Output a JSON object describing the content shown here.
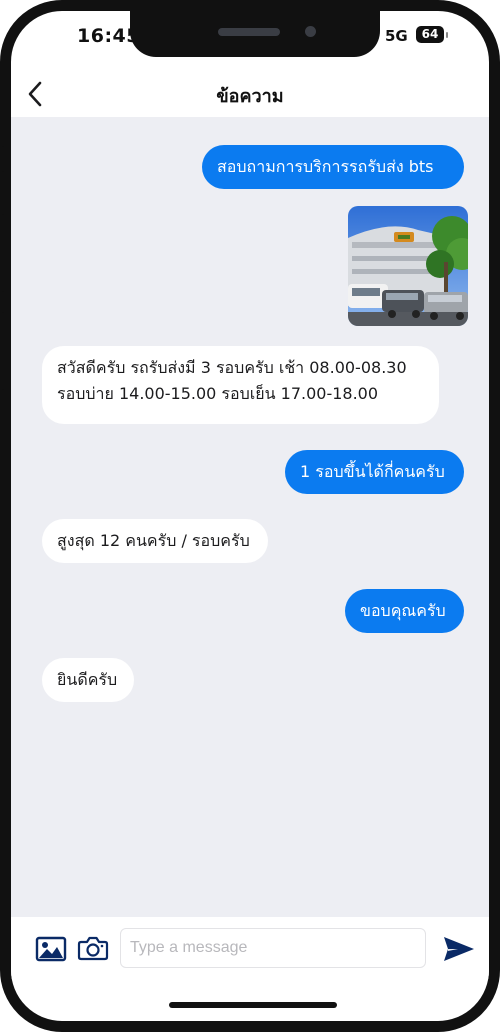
{
  "status_bar": {
    "time": "16:45",
    "network": "5G",
    "battery": "64"
  },
  "header": {
    "title": "ข้อความ",
    "back_icon": "chevron-left-icon"
  },
  "messages": [
    {
      "side": "out",
      "text": "สอบถามการบริการรถรับส่ง bts"
    },
    {
      "side": "out",
      "type": "image",
      "icon": "photo-thumbnail"
    },
    {
      "side": "in",
      "text": "สวัสดีครับ รถรับส่งมี 3 รอบครับ เช้า 08.00-08.30\nรอบบ่าย 14.00-15.00 รอบเย็น 17.00-18.00"
    },
    {
      "side": "out",
      "text": "1 รอบขึ้นได้กี่คนครับ"
    },
    {
      "side": "in",
      "text": "สูงสุด 12 คนครับ / รอบครับ"
    },
    {
      "side": "out",
      "text": "ขอบคุณครับ"
    },
    {
      "side": "in",
      "text": "ยินดีครับ"
    }
  ],
  "composer": {
    "placeholder": "Type a message",
    "value": "",
    "gallery_icon": "image-gallery-icon",
    "camera_icon": "camera-icon",
    "send_icon": "send-icon"
  },
  "colors": {
    "accent": "#0b7bf0",
    "chat_background": "#edeef3",
    "incoming_bubble": "#ffffff",
    "send_icon": "#0a2a66"
  }
}
